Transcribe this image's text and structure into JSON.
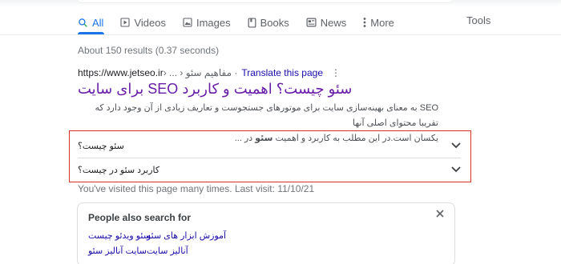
{
  "tabs": [
    {
      "label": "All",
      "icon": "search-icon",
      "active": true
    },
    {
      "label": "Videos",
      "icon": "video-icon",
      "active": false
    },
    {
      "label": "Images",
      "icon": "image-icon",
      "active": false
    },
    {
      "label": "Books",
      "icon": "book-icon",
      "active": false
    },
    {
      "label": "News",
      "icon": "news-icon",
      "active": false
    },
    {
      "label": "More",
      "icon": "more-vertical-icon",
      "active": false
    }
  ],
  "tools_label": "Tools",
  "stats": "About 150 results (0.37 seconds)",
  "result": {
    "url": "https://www.jetseo.ir",
    "breadcrumb": " › ... › مفاهیم سئو",
    "translate_label": "Translate this page",
    "title": "سئو چیست؟ اهمیت و کاربرد SEO برای سایت",
    "snippet_line1": "SEO به معنای بهینه‌سازی سایت برای موتورهای جستجوست و تعاریف زیادی از آن وجود دارد که تقریبا محتوای اصلی آنها",
    "snippet_line2": "یکسان است.در این مطلب به کاربرد و اهمیت",
    "snippet_bold": "سئو",
    "snippet_tail": "در ..."
  },
  "faq": [
    {
      "question": "سئو چیست؟"
    },
    {
      "question": "کاربرد سئو در چیست؟"
    }
  ],
  "visited_note": "You've visited this page many times. Last visit: 11/10/21",
  "people_also_search": {
    "title": "People also search for",
    "links": [
      "آموزش ابزار های سئو",
      "سئو ویدئو چیست",
      "آنالیز سایت",
      "سایت آنالیز سئو"
    ]
  },
  "colors": {
    "accent": "#1a73e8",
    "visited_link": "#681da8",
    "link": "#1a0dab",
    "highlight_border": "#d93025"
  }
}
